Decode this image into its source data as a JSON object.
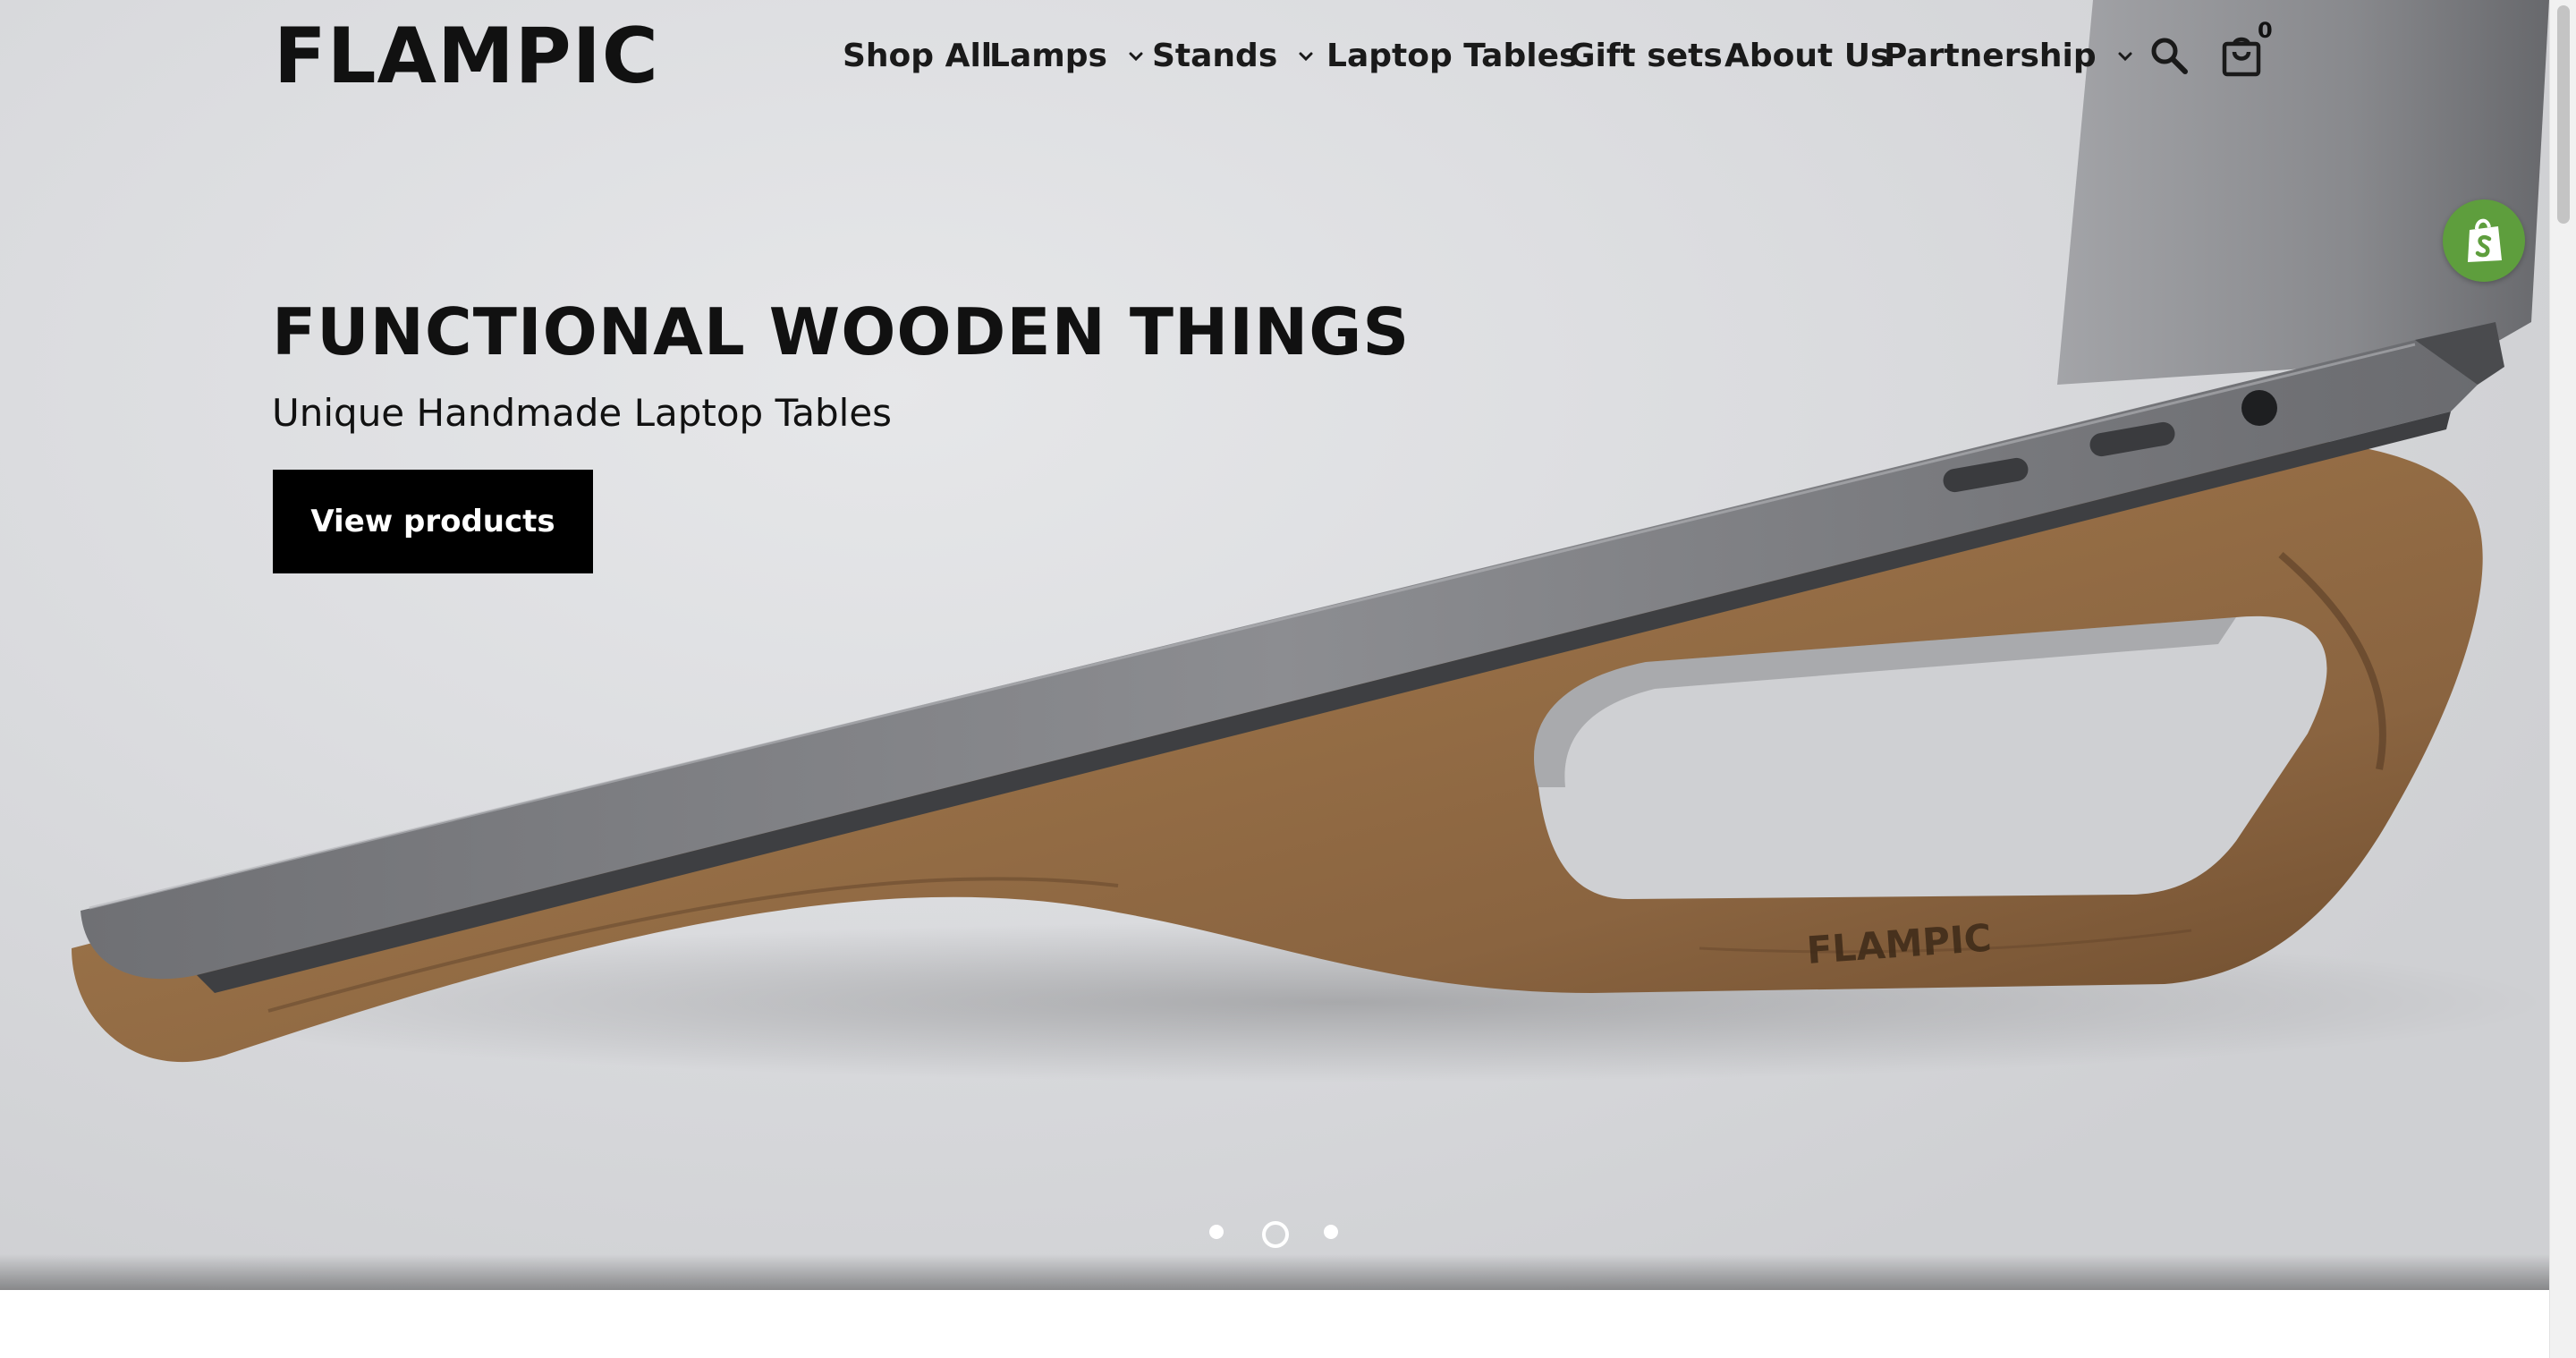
{
  "brand": {
    "logo_text": "FLAMPIC"
  },
  "nav": {
    "items": [
      {
        "label": "Shop All",
        "has_dropdown": false
      },
      {
        "label": "Lamps",
        "has_dropdown": true
      },
      {
        "label": "Stands",
        "has_dropdown": true
      },
      {
        "label": "Laptop Tables",
        "has_dropdown": false
      },
      {
        "label": "Gift sets",
        "has_dropdown": false
      },
      {
        "label": "About Us",
        "has_dropdown": false
      },
      {
        "label": "Partnership",
        "has_dropdown": true
      }
    ],
    "search_icon": "search-icon",
    "cart_icon": "shopping-bag-icon",
    "cart_count": "0"
  },
  "hero": {
    "title": "FUNCTIONAL WOODEN THINGS",
    "subtitle": "Unique Handmade Laptop Tables",
    "cta_label": "View products",
    "stand_engraving": "FLAMPIC",
    "slides_total": 3,
    "active_slide": 2
  },
  "colors": {
    "text": "#111111",
    "cta_background": "#000000",
    "cta_text": "#ffffff",
    "shopify_badge": "#5e9e3d",
    "wood": "#8a6440"
  }
}
